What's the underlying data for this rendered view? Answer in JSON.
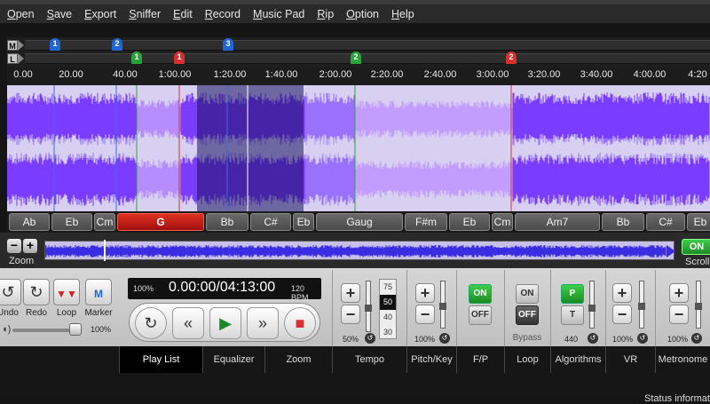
{
  "menu": {
    "items": [
      "Open",
      "Save",
      "Export",
      "Sniffer",
      "Edit",
      "Record",
      "Music Pad",
      "Rip",
      "Option",
      "Help"
    ]
  },
  "marker_rows": {
    "m_label": "M",
    "l_label": "L"
  },
  "markers": [
    {
      "n": "1",
      "color": "blue"
    },
    {
      "n": "2",
      "color": "blue"
    },
    {
      "n": "3",
      "color": "blue"
    },
    {
      "n": "1",
      "color": "green"
    },
    {
      "n": "2",
      "color": "green"
    },
    {
      "n": "1",
      "color": "red"
    },
    {
      "n": "2",
      "color": "red"
    }
  ],
  "timeline": {
    "ticks": [
      "0.00",
      "20.00",
      "40.00",
      "1:00.00",
      "1:20.00",
      "1:40.00",
      "2:00.00",
      "2:20.00",
      "2:40.00",
      "3:00.00",
      "3:20.00",
      "3:40.00",
      "4:00.00",
      "4:20"
    ]
  },
  "chords": [
    {
      "label": "Ab",
      "active": false
    },
    {
      "label": "Eb",
      "active": false
    },
    {
      "label": "Cm",
      "active": false
    },
    {
      "label": "G",
      "active": true
    },
    {
      "label": "Bb",
      "active": false
    },
    {
      "label": "C#",
      "active": false
    },
    {
      "label": "Eb",
      "active": false
    },
    {
      "label": "Gaug",
      "active": false
    },
    {
      "label": "F#m",
      "active": false
    },
    {
      "label": "Eb",
      "active": false
    },
    {
      "label": "Cm",
      "active": false
    },
    {
      "label": "Am7",
      "active": false
    },
    {
      "label": "Bb",
      "active": false
    },
    {
      "label": "C#",
      "active": false
    },
    {
      "label": "Eb",
      "active": false
    }
  ],
  "overview": {
    "zoom_label": "Zoom",
    "zoom_minus": "−",
    "zoom_plus": "+",
    "scroll_toggle": "ON",
    "scroll_label": "Scroll"
  },
  "edit_buttons": {
    "undo": "Undo",
    "redo": "Redo",
    "loop": "Loop",
    "marker": "Marker",
    "volume": "100%"
  },
  "lcd": {
    "speed": "100%",
    "time": "0.00:00/04:13:00",
    "bpm": "120 BPM"
  },
  "tempo": {
    "list": [
      "75",
      "50",
      "40",
      "30"
    ],
    "selected": "50",
    "value": "50%"
  },
  "pitch": {
    "value": "100%"
  },
  "fp": {
    "on": "ON",
    "off": "OFF"
  },
  "loop_bypass": {
    "on": "ON",
    "off": "OFF",
    "label": "Bypass"
  },
  "algorithms": {
    "p": "P",
    "t": "T",
    "value": "440"
  },
  "vr": {
    "value": "100%"
  },
  "metronome": {
    "value": "100%"
  },
  "tabs": [
    "Play List",
    "Equalizer",
    "Zoom",
    "Tempo",
    "Pitch/Key",
    "F/P",
    "Loop",
    "Algorithms",
    "VR",
    "Metronome"
  ],
  "status": {
    "text": "Status informat"
  },
  "colors": {
    "wave_purple": "#7a3dff",
    "wave_blue": "#4a40e0",
    "active_chord": "#d02818",
    "on_green": "#2aa33a"
  }
}
